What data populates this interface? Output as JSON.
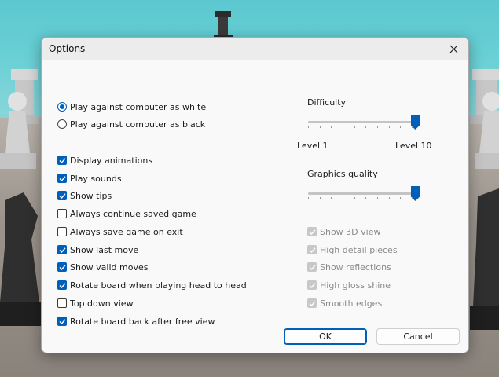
{
  "dialog": {
    "title": "Options",
    "close_icon": "close-icon"
  },
  "play_mode": {
    "options": [
      {
        "label": "Play against computer as white",
        "selected": true
      },
      {
        "label": "Play against computer as black",
        "selected": false
      }
    ]
  },
  "settings": [
    {
      "label": "Display animations",
      "checked": true
    },
    {
      "label": "Play sounds",
      "checked": true
    },
    {
      "label": "Show tips",
      "checked": true
    },
    {
      "label": "Always continue saved game",
      "checked": false
    },
    {
      "label": "Always save game on exit",
      "checked": false
    },
    {
      "label": "Show last move",
      "checked": true
    },
    {
      "label": "Show valid moves",
      "checked": true
    },
    {
      "label": "Rotate board when playing head to head",
      "checked": true
    },
    {
      "label": "Top down view",
      "checked": false
    },
    {
      "label": "Rotate board back after free view",
      "checked": true
    }
  ],
  "difficulty": {
    "label": "Difficulty",
    "min_label": "Level 1",
    "max_label": "Level 10",
    "level": 10,
    "max": 10
  },
  "graphics": {
    "label": "Graphics quality",
    "level": 1.0,
    "options": [
      {
        "label": "Show 3D view",
        "checked": true,
        "disabled": true
      },
      {
        "label": "High detail pieces",
        "checked": true,
        "disabled": true
      },
      {
        "label": "Show reflections",
        "checked": true,
        "disabled": true
      },
      {
        "label": "High gloss shine",
        "checked": true,
        "disabled": true
      },
      {
        "label": "Smooth edges",
        "checked": true,
        "disabled": true
      }
    ]
  },
  "buttons": {
    "ok": "OK",
    "cancel": "Cancel"
  },
  "colors": {
    "accent": "#005fb8",
    "disabled": "#c8c8c8"
  }
}
